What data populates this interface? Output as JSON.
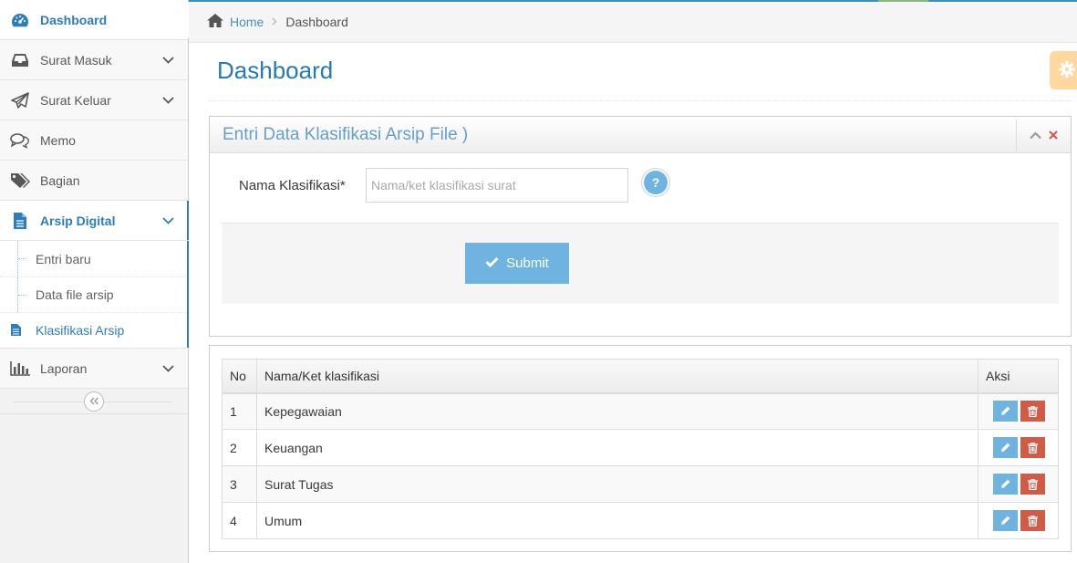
{
  "sidebar": {
    "items": [
      {
        "label": "Dashboard",
        "icon": "tachometer-icon"
      },
      {
        "label": "Surat Masuk",
        "icon": "inbox-icon"
      },
      {
        "label": "Surat Keluar",
        "icon": "paper-plane-icon"
      },
      {
        "label": "Memo",
        "icon": "comments-icon"
      },
      {
        "label": "Bagian",
        "icon": "tags-icon"
      },
      {
        "label": "Arsip Digital",
        "icon": "file-text-icon"
      },
      {
        "label": "Laporan",
        "icon": "bar-chart-icon"
      }
    ],
    "submenu": [
      "Entri baru",
      "Data file arsip",
      "Klasifikasi Arsip"
    ]
  },
  "breadcrumb": {
    "home": "Home",
    "current": "Dashboard"
  },
  "page": {
    "title": "Dashboard"
  },
  "form": {
    "title": "Entri Data Klasifikasi Arsip File )",
    "label": "Nama Klasifikasi*",
    "placeholder": "Nama/ket klasifikasi surat",
    "value": "",
    "help": "?",
    "submit_label": "Submit"
  },
  "table": {
    "headers": [
      "No",
      "Nama/Ket klasifikasi",
      "Aksi"
    ],
    "rows": [
      {
        "no": "1",
        "name": "Kepegawaian"
      },
      {
        "no": "2",
        "name": "Keuangan"
      },
      {
        "no": "3",
        "name": "Surat Tugas"
      },
      {
        "no": "4",
        "name": "Umum"
      }
    ]
  },
  "colors": {
    "primary": "#2b7dbc",
    "info": "#6fb3e0",
    "danger": "#d15b47",
    "warning": "#ffb752"
  }
}
